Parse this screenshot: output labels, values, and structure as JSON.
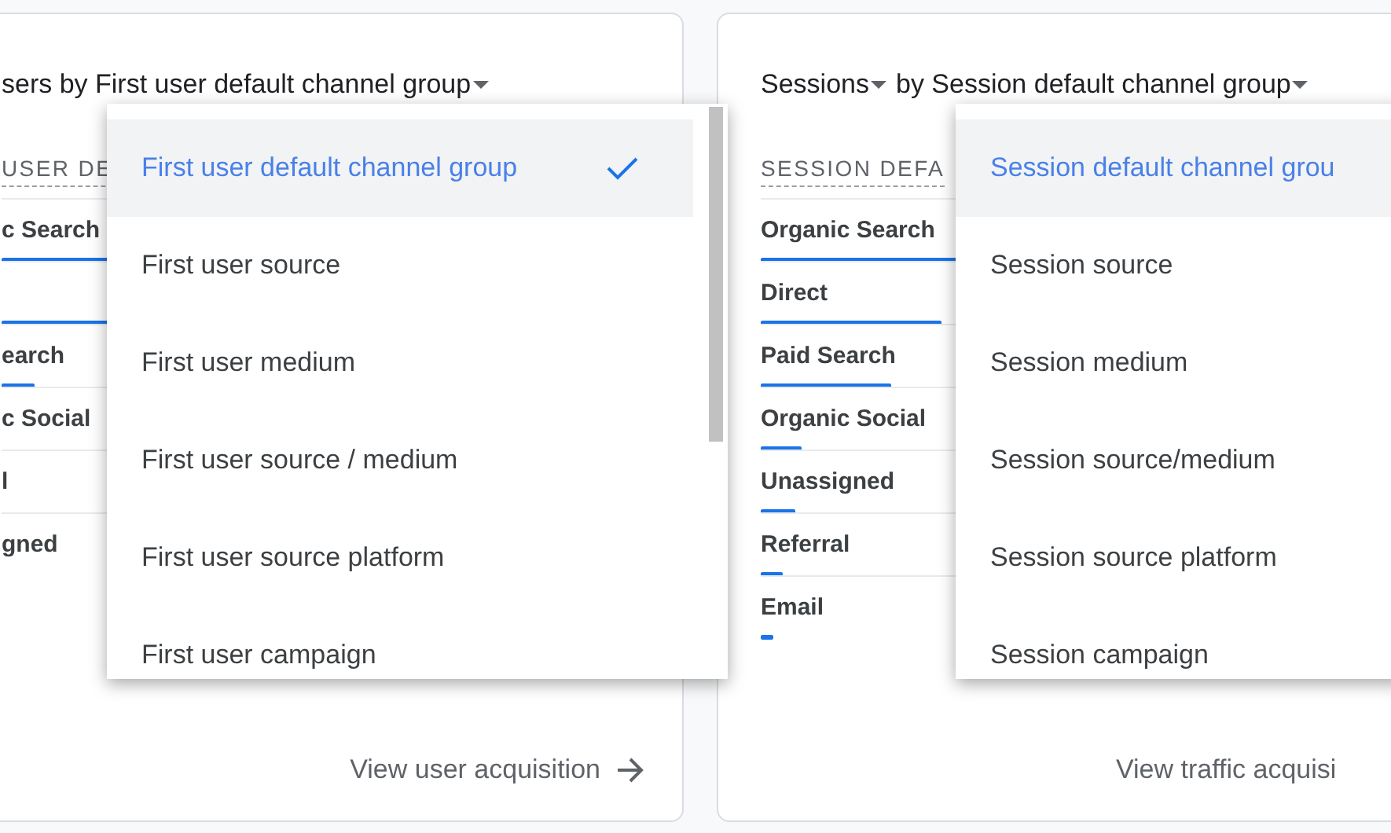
{
  "cards": [
    {
      "title": "sers by First user default channel group",
      "column_header": "USER DE",
      "rows": [
        {
          "label": "c Search",
          "level": 0.45
        },
        {
          "label": "",
          "level": 0.45
        },
        {
          "label": "earch",
          "level": 0.13
        },
        {
          "label": "c Social"
        },
        {
          "label": "l"
        },
        {
          "label": "gned"
        }
      ],
      "menu": {
        "items": [
          {
            "label": "First user default channel group",
            "selected": true
          },
          {
            "label": "First user source",
            "selected": false
          },
          {
            "label": "First user medium",
            "selected": false
          },
          {
            "label": "First user source / medium",
            "selected": false
          },
          {
            "label": "First user source platform",
            "selected": false
          },
          {
            "label": "First user campaign",
            "selected": false
          }
        ]
      },
      "footer_link": "View user acquisition",
      "footer_arrow": true
    },
    {
      "title": "by Session default channel group",
      "metric": "Sessions",
      "column_header": "SESSION DEFA",
      "rows": [
        {
          "label": "Organic Search",
          "level": 0.9
        },
        {
          "label": "Direct",
          "level": 0.72
        },
        {
          "label": "Paid Search",
          "level": 0.52
        },
        {
          "label": "Organic Social",
          "level": 0.16
        },
        {
          "label": "Unassigned",
          "level": 0.14
        },
        {
          "label": "Referral",
          "level": 0.09
        },
        {
          "label": "Email",
          "level": 0.05
        }
      ],
      "menu": {
        "items": [
          {
            "label": "Session default channel grou",
            "selected": true
          },
          {
            "label": "Session source",
            "selected": false
          },
          {
            "label": "Session medium",
            "selected": false
          },
          {
            "label": "Session source/medium",
            "selected": false
          },
          {
            "label": "Session source platform",
            "selected": false
          },
          {
            "label": "Session campaign",
            "selected": false
          }
        ]
      },
      "footer_link": "View traffic acquisi",
      "footer_arrow": false
    }
  ]
}
